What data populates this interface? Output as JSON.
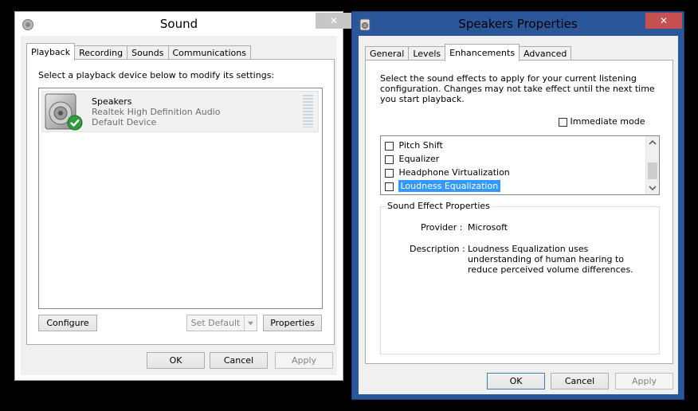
{
  "sound_window": {
    "title": "Sound",
    "close_glyph": "✕",
    "tabs": [
      "Playback",
      "Recording",
      "Sounds",
      "Communications"
    ],
    "instruction": "Select a playback device below to modify its settings:",
    "device": {
      "name": "Speakers",
      "driver": "Realtek High Definition Audio",
      "status": "Default Device",
      "status_icon": "green-checkmark-icon"
    },
    "buttons": {
      "configure": "Configure",
      "set_default": "Set Default",
      "properties": "Properties",
      "ok": "OK",
      "cancel": "Cancel",
      "apply": "Apply"
    }
  },
  "properties_window": {
    "title": "Speakers Properties",
    "close_glyph": "✕",
    "tabs": [
      "General",
      "Levels",
      "Enhancements",
      "Advanced"
    ],
    "active_tab": "Enhancements",
    "instruction": "Select the sound effects to apply for your current listening configuration. Changes may not take effect until the next time you start playback.",
    "immediate_mode_label": "Immediate mode",
    "immediate_mode_checked": false,
    "effects": [
      {
        "label": "Pitch Shift",
        "checked": false
      },
      {
        "label": "Equalizer",
        "checked": false
      },
      {
        "label": "Headphone Virtualization",
        "checked": false
      },
      {
        "label": "Loudness Equalization",
        "checked": false,
        "selected": true
      }
    ],
    "group_title": "Sound Effect Properties",
    "provider_label": "Provider :",
    "provider_value": "Microsoft",
    "description_label": "Description :",
    "description_value": "Loudness Equalization uses understanding of human hearing to reduce perceived volume differences.",
    "buttons": {
      "ok": "OK",
      "cancel": "Cancel",
      "apply": "Apply"
    }
  },
  "colors": {
    "inactive_frame": "#ffffff",
    "active_frame": "#2b579a",
    "close_inactive": "#c7c7c7",
    "close_active": "#c75050",
    "selection": "#3399ff"
  }
}
